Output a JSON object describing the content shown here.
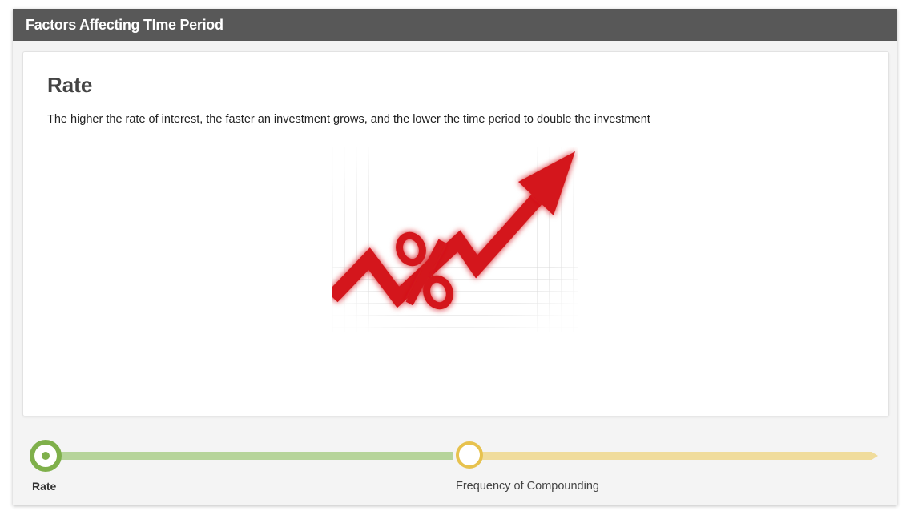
{
  "window": {
    "title": "Factors Affecting TIme Period"
  },
  "slide": {
    "heading": "Rate",
    "description": "The higher the rate of interest, the faster an investment grows, and the lower the time period to double the investment",
    "image_icon": "percent-arrow-up-icon"
  },
  "timeline": {
    "steps": [
      {
        "label": "Rate",
        "state": "active"
      },
      {
        "label": "Frequency of Compounding",
        "state": "upcoming"
      }
    ]
  },
  "colors": {
    "titlebar": "#585858",
    "active_step": "#7fb04b",
    "active_track": "#b6d49a",
    "upcoming_step": "#e7c24e",
    "upcoming_track": "#f0dc9c",
    "arrow_red": "#d4141b"
  }
}
